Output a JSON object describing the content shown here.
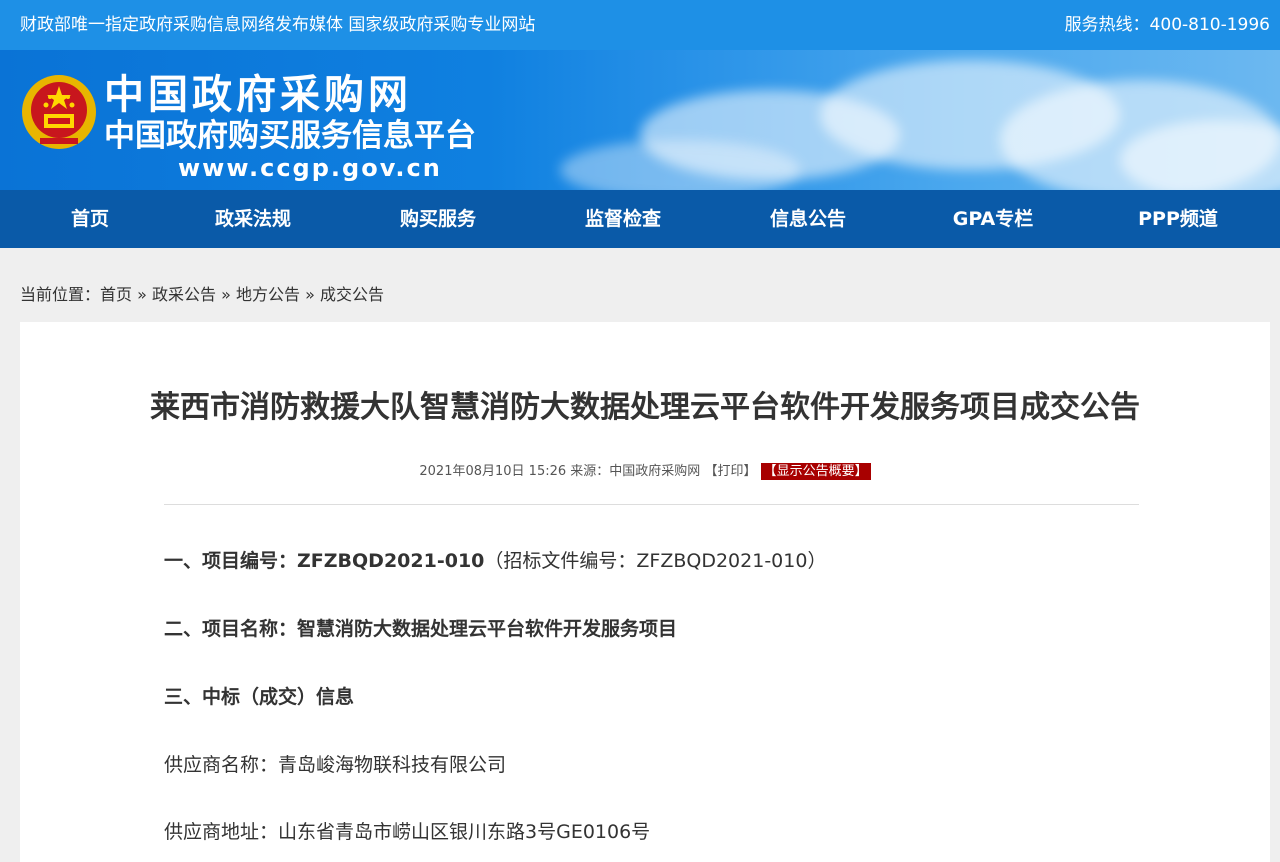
{
  "topbar": {
    "slogan": "财政部唯一指定政府采购信息网络发布媒体 国家级政府采购专业网站",
    "hotline": "服务热线：400-810-1996"
  },
  "header": {
    "name_line1": "中国政府采购网",
    "name_line2": "中国政府购买服务信息平台",
    "url": "www.ccgp.gov.cn"
  },
  "nav": {
    "items": [
      "首页",
      "政采法规",
      "购买服务",
      "监督检查",
      "信息公告",
      "GPA专栏",
      "PPP频道"
    ]
  },
  "breadcrumb": {
    "prefix": "当前位置：",
    "items": [
      "首页",
      "政采公告",
      "地方公告",
      "成交公告"
    ],
    "sep": "»"
  },
  "article": {
    "title": "莱西市消防救援大队智慧消防大数据处理云平台软件开发服务项目成交公告",
    "datetime": "2021年08月10日 15:26",
    "source_label": "来源：",
    "source": "中国政府采购网",
    "print": "【打印】",
    "summary": "【显示公告概要】",
    "sections": {
      "s1_label": "一、项目编号：",
      "s1_value": "ZFZBQD2021-010",
      "s1_note": "（招标文件编号：ZFZBQD2021-010）",
      "s2_label": "二、项目名称：",
      "s2_value": "智慧消防大数据处理云平台软件开发服务项目",
      "s3_label": "三、中标（成交）信息",
      "supplier_name_label": "供应商名称：",
      "supplier_name": "青岛峻海物联科技有限公司",
      "supplier_addr_label": "供应商地址：",
      "supplier_addr": "山东省青岛市崂山区银川东路3号GE0106号"
    }
  },
  "colors": {
    "topbar": "#1e90e6",
    "nav": "#0a5aa8",
    "summary_bg": "#a80000"
  }
}
